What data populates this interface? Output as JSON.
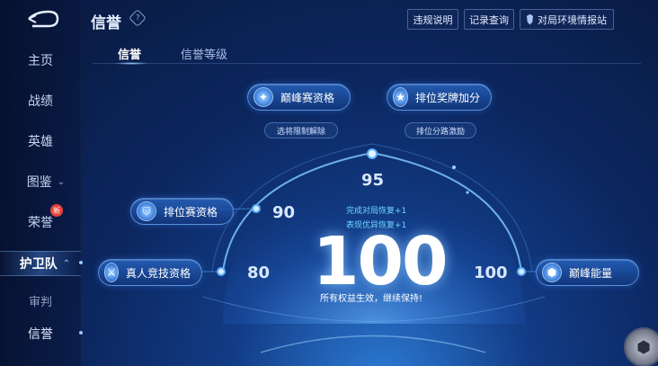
{
  "header": {
    "title": "信誉",
    "help_icon": "?",
    "buttons": [
      "违规说明",
      "记录查询",
      "对局环境情报站"
    ]
  },
  "sidebar": {
    "items": [
      {
        "label": "主页"
      },
      {
        "label": "战绩"
      },
      {
        "label": "英雄"
      },
      {
        "label": "图鉴",
        "chevron": "⌄"
      },
      {
        "label": "荣誉",
        "badge": "新"
      },
      {
        "label": "护卫队",
        "chevron": "⌃",
        "active": true
      },
      {
        "label": "审判"
      },
      {
        "label": "信誉"
      }
    ]
  },
  "tabs": [
    {
      "label": "信誉",
      "active": true
    },
    {
      "label": "信誉等级",
      "active": false
    }
  ],
  "privileges": {
    "peak_match": {
      "label": "巅峰赛资格",
      "sub": "选将限制解除",
      "icon": "diamond-crest-icon"
    },
    "rank_medal": {
      "label": "排位奖牌加分",
      "sub": "排位分路激励",
      "icon": "star-medal-icon"
    },
    "ranked_match": {
      "label": "排位赛资格",
      "icon": "shield-icon"
    },
    "real_person": {
      "label": "真人竞技资格",
      "icon": "crossed-swords-icon"
    },
    "peak_energy": {
      "label": "巅峰能量",
      "icon": "hexagon-energy-icon"
    }
  },
  "gauge": {
    "thresholds": [
      "80",
      "90",
      "95",
      "100"
    ],
    "score": "100",
    "bonus_lines": [
      "完成对局恢复+1",
      "表现优异恢复+1"
    ],
    "status": "所有权益生效，继续保持!"
  },
  "colors": {
    "accent": "#6fd7ff",
    "background": "#0c2760",
    "badge_red": "#e4433b"
  }
}
